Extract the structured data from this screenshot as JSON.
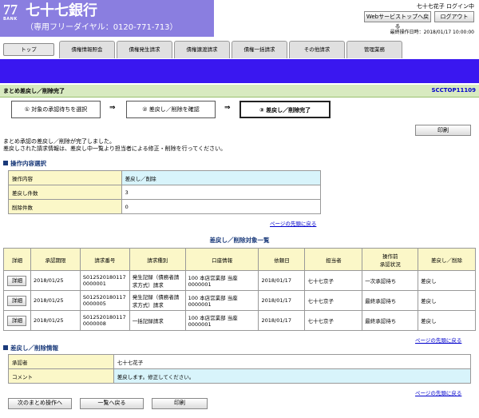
{
  "header": {
    "logo_number": "77",
    "logo_bank": "BANK",
    "bank_name": "七十七銀行",
    "hotline": "（専用フリーダイヤル：0120-771-713）",
    "user_status": "七十七花子 ログイン中",
    "web_service_top_button": "Webサービストップへ戻る",
    "logout_button": "ログアウト",
    "last_operation": "最終操作日時：2018/01/17 10:00:00"
  },
  "nav": {
    "top": "トップ",
    "tabs": [
      "債権情報照会",
      "債権発生請求",
      "債権譲渡請求",
      "債権一括請求",
      "その他請求",
      "管理業務"
    ]
  },
  "page": {
    "title": "まとめ差戻し／削除完了",
    "screen_code": "SCCTOP11109"
  },
  "steps": {
    "step1": "① 対象の承認待ちを選択",
    "step2": "② 差戻し／削除を確認",
    "step3": "③ 差戻し／削除完了",
    "arrow": "⇒"
  },
  "print_label": "印刷",
  "message": {
    "line1": "まとめ承認の差戻し／削除が完了しました。",
    "line2": "差戻しされた請求情報は、差戻し中一覧より担当者による修正・削除を行ってください。"
  },
  "ops_section": {
    "heading": "操作内容選択",
    "rows": [
      {
        "label": "操作内容",
        "value": "差戻し／削除"
      },
      {
        "label": "差戻し件数",
        "value": "3"
      },
      {
        "label": "削除件数",
        "value": "0"
      }
    ]
  },
  "page_top_link": "ページの先頭に戻る",
  "list": {
    "title": "差戻し／削除対象一覧",
    "headers": [
      "詳細",
      "承認期限",
      "請求番号",
      "請求種別",
      "口座情報",
      "依頼日",
      "担当者",
      "操作前\n承認状況",
      "差戻し／削除"
    ],
    "detail_label": "詳細",
    "rows": [
      {
        "deadline": "2018/01/25",
        "request_no": "S0125201801170000001",
        "request_type": "発生記録（債務者請求方式）請求",
        "account": "100 本店営業部 当座 0000001",
        "request_date": "2018/01/17",
        "person": "七十七京子",
        "status": "一次承認待ち",
        "action": "差戻し"
      },
      {
        "deadline": "2018/01/25",
        "request_no": "S0125201801170000005",
        "request_type": "発生記録（債務者請求方式）請求",
        "account": "100 本店営業部 当座 0000001",
        "request_date": "2018/01/17",
        "person": "七十七京子",
        "status": "最終承認待ち",
        "action": "差戻し"
      },
      {
        "deadline": "2018/01/25",
        "request_no": "S0125201801170000008",
        "request_type": "一括記録請求",
        "account": "100 本店営業部 当座 0000001",
        "request_date": "2018/01/17",
        "person": "七十七京子",
        "status": "最終承認待ち",
        "action": "差戻し"
      }
    ]
  },
  "info_section": {
    "heading": "差戻し／削除情報",
    "approver_label": "承認者",
    "approver_value": "七十七花子",
    "comment_label": "コメント",
    "comment_value": "差戻します。修正してください。"
  },
  "bottom_buttons": {
    "next": "次のまとめ操作へ",
    "back_list": "一覧へ戻る",
    "print": "印刷"
  }
}
